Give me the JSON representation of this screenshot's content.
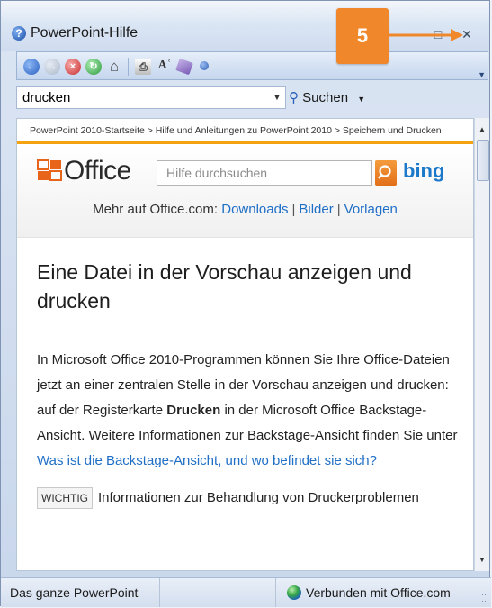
{
  "window": {
    "title": "PowerPoint-Hilfe"
  },
  "overlay": {
    "badge": "5"
  },
  "toolbar": {
    "icons": [
      "back-icon",
      "forward-icon",
      "stop-icon",
      "refresh-icon",
      "home-icon",
      "print-icon",
      "font-size-icon",
      "book-icon",
      "pin-icon"
    ]
  },
  "search": {
    "value": "drucken",
    "button_label": "Suchen"
  },
  "breadcrumb": "PowerPoint 2010-Startseite > Hilfe und Anleitungen zu PowerPoint 2010 > Speichern und Drucken",
  "office": {
    "logo": "Office",
    "search_placeholder": "Hilfe durchsuchen",
    "bing": "bing",
    "more_prefix": "Mehr auf Office.com:",
    "links": [
      "Downloads",
      "Bilder",
      "Vorlagen"
    ]
  },
  "article": {
    "title": "Eine Datei in der Vorschau anzeigen und drucken",
    "para_part1": "In Microsoft Office 2010-Programmen können Sie Ihre Office-Dateien jetzt an einer zentralen Stelle in der Vorschau anzeigen und drucken: auf der Registerkarte ",
    "para_bold": "Drucken",
    "para_part2": " in der Microsoft Office Backstage-Ansicht. Weitere Informationen zur Backstage-Ansicht finden Sie unter ",
    "para_link": "Was ist die Backstage-Ansicht, und wo befindet sie sich?",
    "note_label": "WICHTIG",
    "note_text": "Informationen zur Behandlung von Druckerproblemen"
  },
  "status": {
    "scope": "Das ganze PowerPoint",
    "connection": "Verbunden mit Office.com"
  },
  "colors": {
    "accent_orange": "#f0882b",
    "link_blue": "#1f6fc6",
    "office_rule": "#f2a30f"
  }
}
